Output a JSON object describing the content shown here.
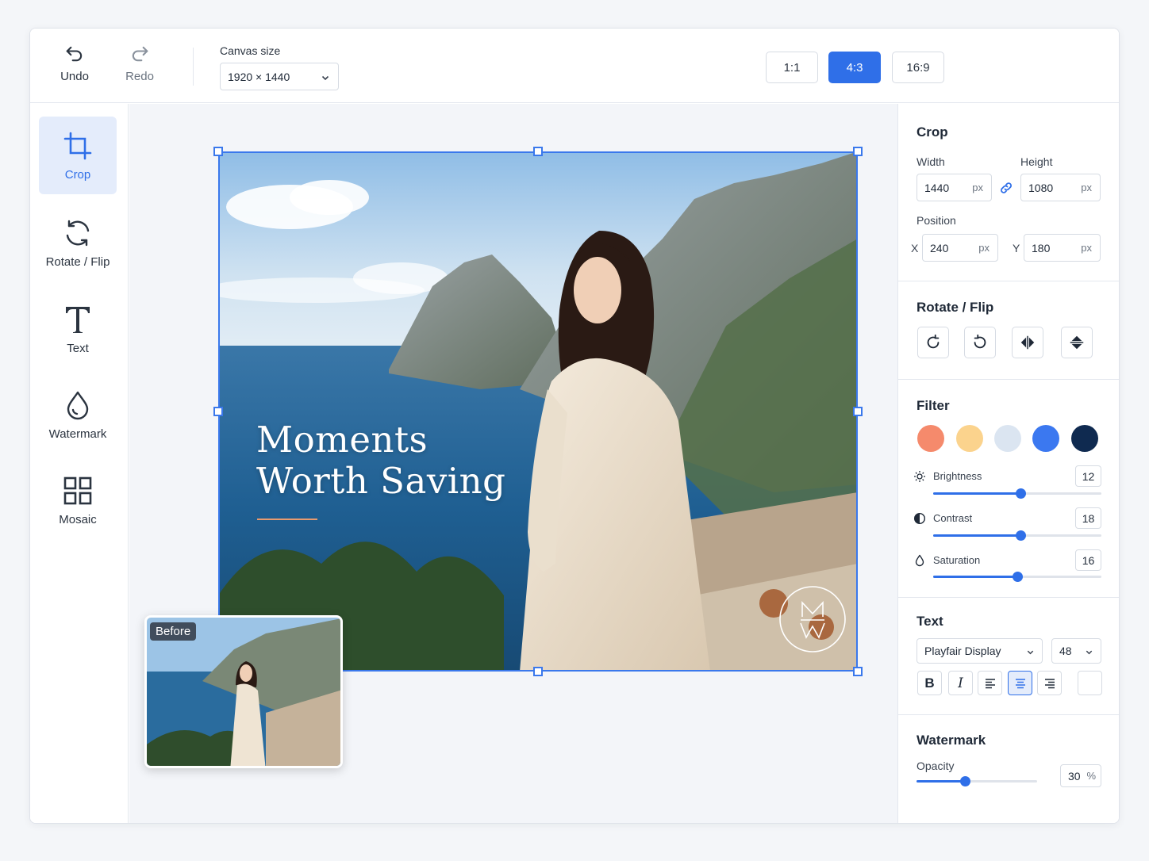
{
  "toolbar": {
    "undo_label": "Undo",
    "redo_label": "Redo",
    "canvas_size_label": "Canvas size",
    "canvas_size_value": "1920 × 1440",
    "ratios": [
      {
        "label": "1:1",
        "active": false
      },
      {
        "label": "4:3",
        "active": true
      },
      {
        "label": "16:9",
        "active": false
      }
    ]
  },
  "tools": [
    {
      "label": "Crop",
      "icon": "crop-icon",
      "active": true
    },
    {
      "label": "Rotate / Flip",
      "icon": "rotate-icon",
      "active": false
    },
    {
      "label": "Text",
      "icon": "text-icon",
      "active": false
    },
    {
      "label": "Watermark",
      "icon": "droplet-icon",
      "active": false
    },
    {
      "label": "Mosaic",
      "icon": "grid-icon",
      "active": false
    }
  ],
  "canvas": {
    "overlay_title_line1": "Moments",
    "overlay_title_line2": "Worth Saving",
    "watermark_monogram": "MW",
    "before_label": "Before"
  },
  "panel": {
    "crop": {
      "title": "Crop",
      "width_label": "Width",
      "height_label": "Height",
      "width_value": "1440",
      "height_value": "1080",
      "unit": "px",
      "position_label": "Position",
      "x_label": "X",
      "y_label": "Y",
      "x_value": "240",
      "y_value": "180"
    },
    "rotate": {
      "title": "Rotate / Flip",
      "buttons": [
        "rotate-right-icon",
        "rotate-left-icon",
        "flip-horizontal-icon",
        "flip-vertical-icon"
      ]
    },
    "filter": {
      "title": "Filter",
      "swatches": [
        "#f58a6c",
        "#fbd38d",
        "#dbe5f1",
        "#3b78f0",
        "#0f2a50"
      ],
      "adjustments": [
        {
          "label": "Brightness",
          "value": "12",
          "level": 0.52
        },
        {
          "label": "Contrast",
          "value": "18",
          "level": 0.52
        },
        {
          "label": "Saturation",
          "value": "16",
          "level": 0.5
        }
      ]
    },
    "text": {
      "title": "Text",
      "font": "Playfair Display",
      "size": "48",
      "bold": "B",
      "italic": "I"
    },
    "watermark": {
      "title": "Watermark",
      "opacity_label": "Opacity",
      "opacity_value": "30",
      "opacity_unit": "%",
      "opacity_level": 0.4
    }
  },
  "colors": {
    "accent": "#2f6fe8",
    "accent_soft": "#e4ecfb"
  }
}
